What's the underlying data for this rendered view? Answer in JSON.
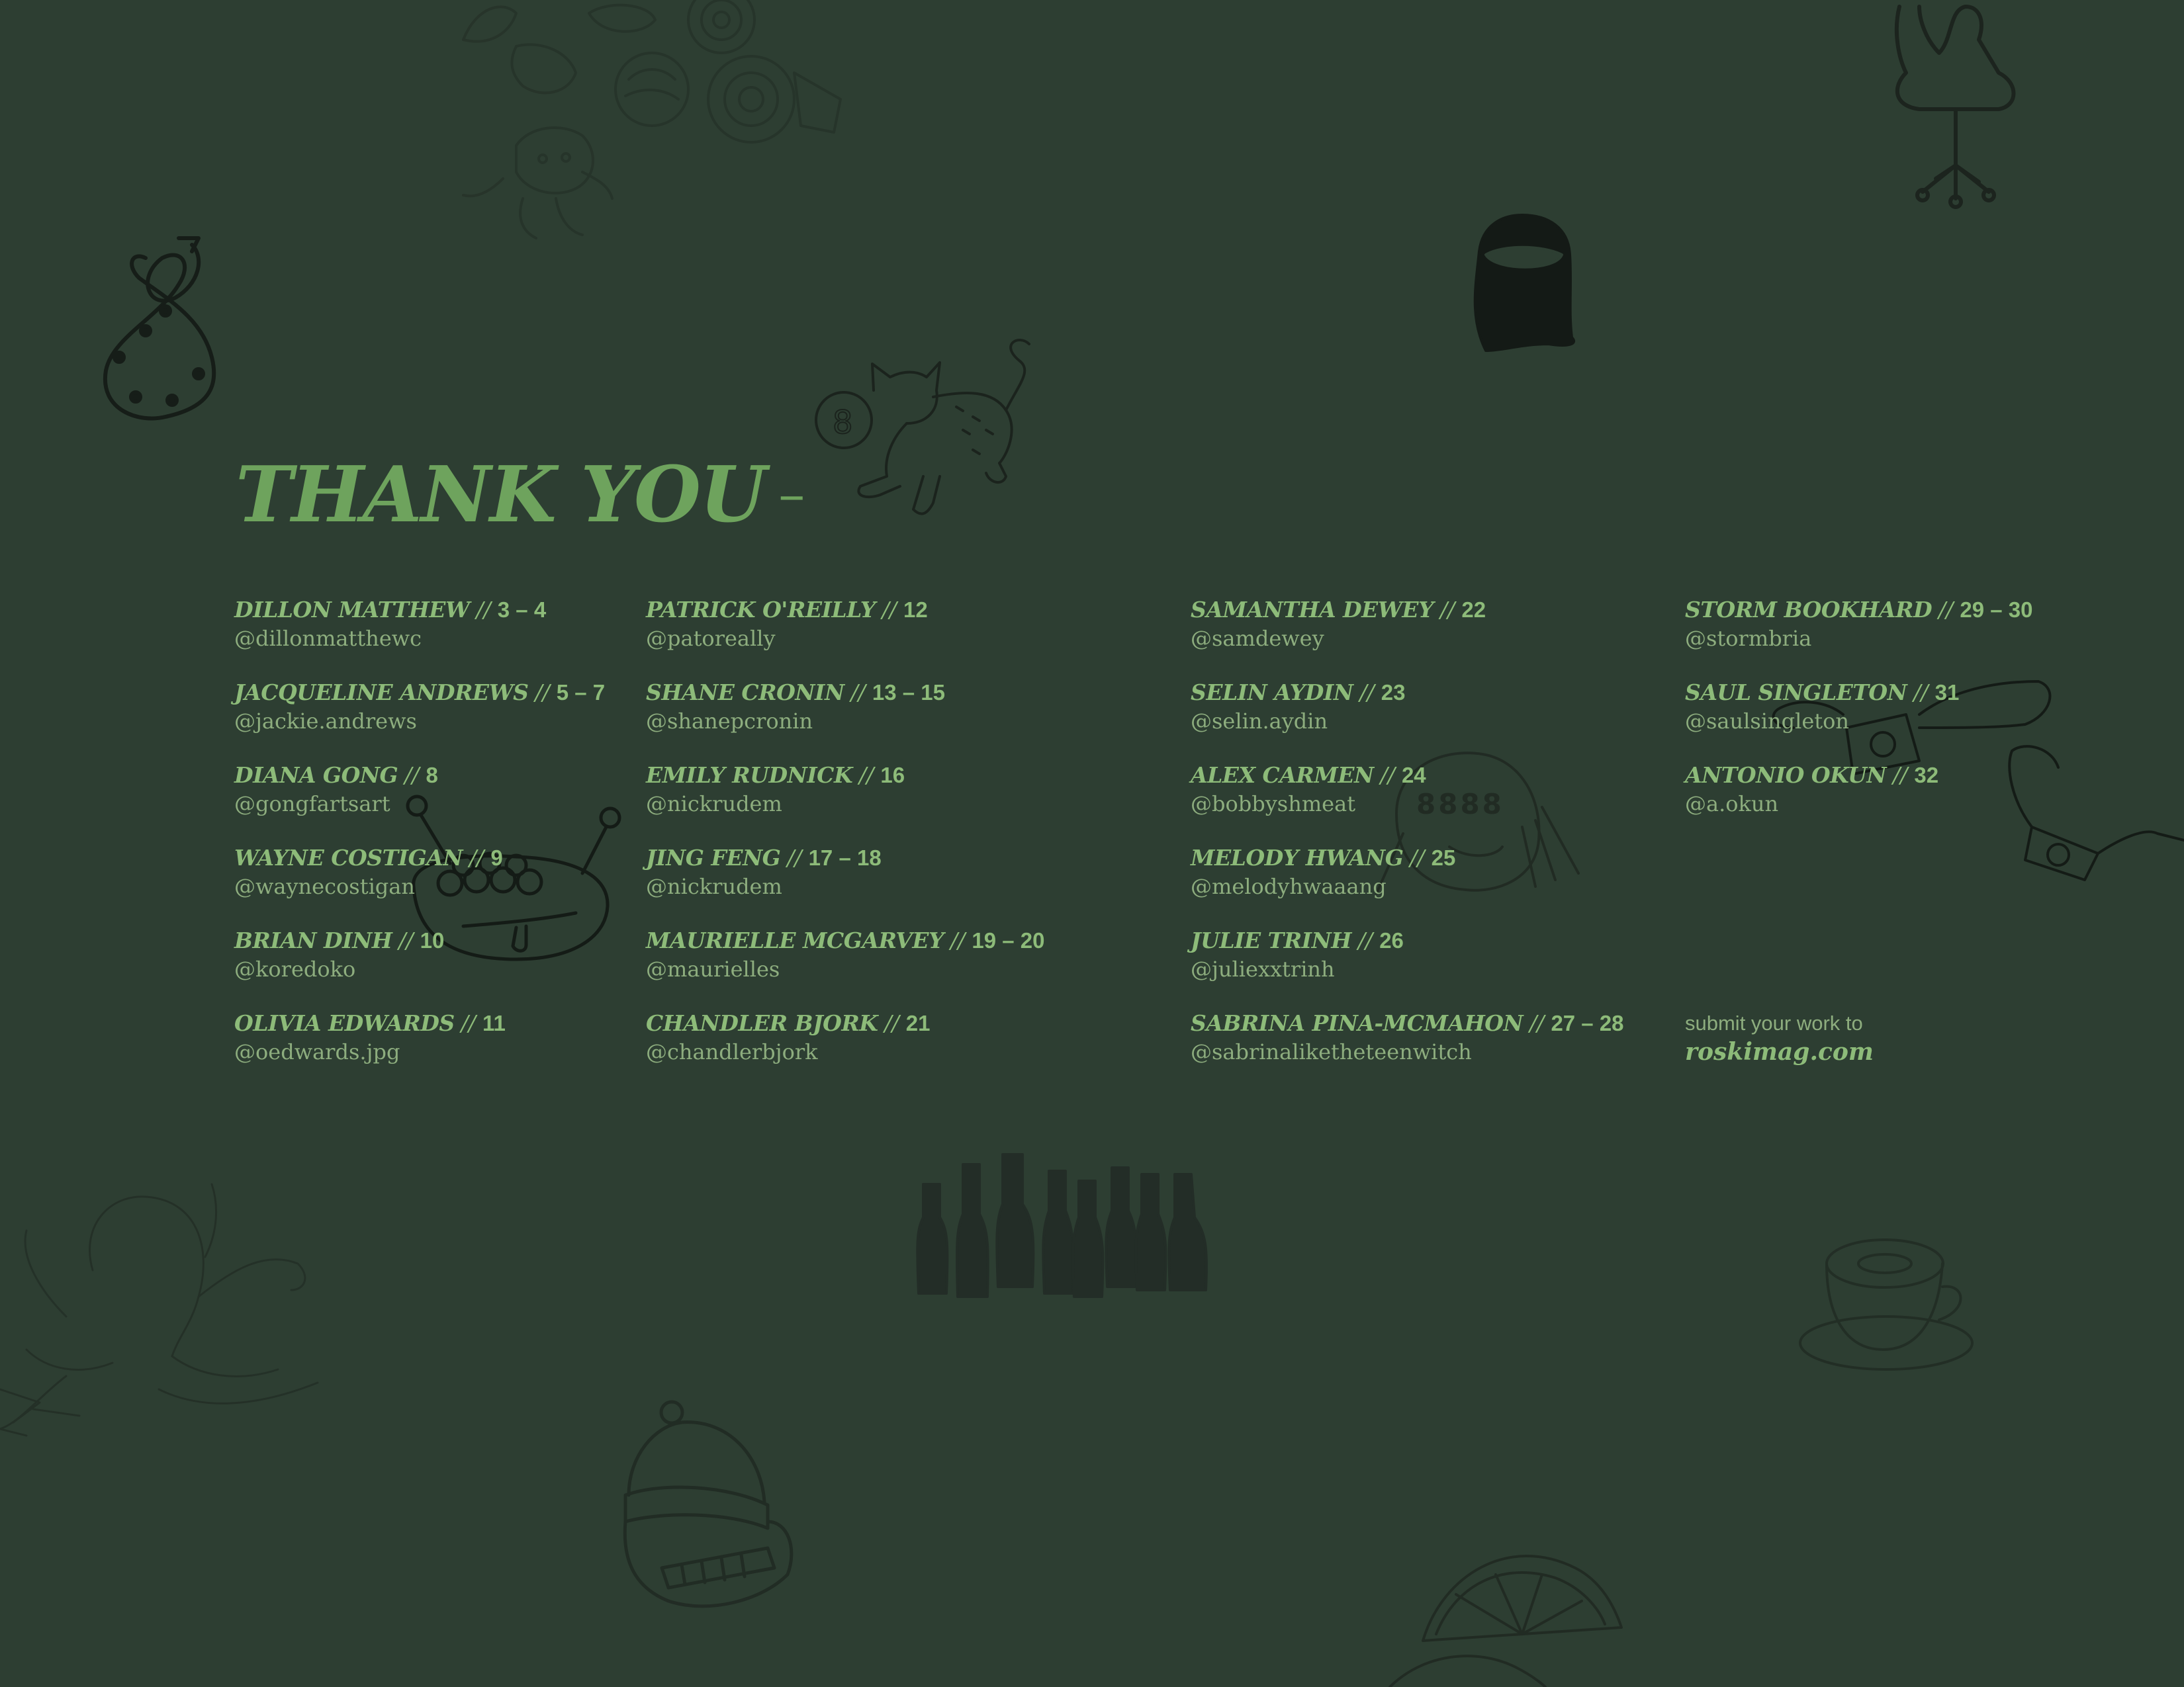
{
  "title": "THANK YOU",
  "title_dash": "–",
  "separator": "//",
  "columns": [
    [
      {
        "name": "DILLON MATTHEW",
        "pages": "3 – 4",
        "handle": "@dillonmatthewc"
      },
      {
        "name": "JACQUELINE ANDREWS",
        "pages": "5 – 7",
        "handle": "@jackie.andrews"
      },
      {
        "name": "DIANA GONG",
        "pages": "8",
        "handle": "@gongfartsart"
      },
      {
        "name": "WAYNE COSTIGAN",
        "pages": "9",
        "handle": "@waynecostigan"
      },
      {
        "name": "BRIAN DINH",
        "pages": "10",
        "handle": "@koredoko"
      },
      {
        "name": "OLIVIA EDWARDS",
        "pages": "11",
        "handle": "@oedwards.jpg"
      }
    ],
    [
      {
        "name": "PATRICK O'REILLY",
        "pages": "12",
        "handle": "@patoreally"
      },
      {
        "name": "SHANE CRONIN",
        "pages": "13 – 15",
        "handle": "@shanepcronin"
      },
      {
        "name": "EMILY RUDNICK",
        "pages": "16",
        "handle": "@nickrudem"
      },
      {
        "name": "JING FENG",
        "pages": "17 – 18",
        "handle": "@nickrudem"
      },
      {
        "name": "MAURIELLE MCGARVEY",
        "pages": "19 – 20",
        "handle": "@maurielles"
      },
      {
        "name": "CHANDLER BJORK",
        "pages": "21",
        "handle": "@chandlerbjork"
      }
    ],
    [
      {
        "name": "SAMANTHA DEWEY",
        "pages": "22",
        "handle": "@samdewey"
      },
      {
        "name": "SELIN AYDIN",
        "pages": "23",
        "handle": "@selin.aydin"
      },
      {
        "name": "ALEX CARMEN",
        "pages": "24",
        "handle": "@bobbyshmeat"
      },
      {
        "name": "MELODY HWANG",
        "pages": "25",
        "handle": "@melodyhwaaang"
      },
      {
        "name": "JULIE TRINH",
        "pages": "26",
        "handle": "@juliexxtrinh"
      },
      {
        "name": "SABRINA PINA-MCMAHON",
        "pages": "27 – 28",
        "handle": "@sabrinaliketheteenwitch"
      }
    ],
    [
      {
        "name": "STORM BOOKHARD",
        "pages": "29 – 30",
        "handle": "@stormbria"
      },
      {
        "name": "SAUL SINGLETON",
        "pages": "31",
        "handle": "@saulsingleton"
      },
      {
        "name": "ANTONIO OKUN",
        "pages": "32",
        "handle": "@a.okun"
      }
    ]
  ],
  "submit": {
    "label": "submit your work to",
    "url": "roskimag.com"
  },
  "colors": {
    "background": "#2d3e32",
    "title": "#6ea35d",
    "name": "#8dbb79",
    "handle": "#8dad7e",
    "doodle": "#1f2a23"
  }
}
